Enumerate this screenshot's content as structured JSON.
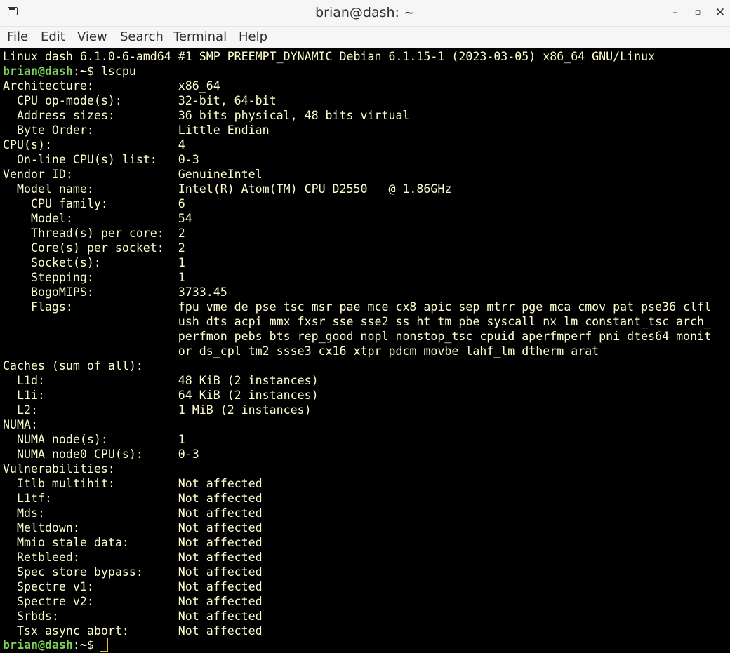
{
  "window": {
    "title": "brian@dash: ~",
    "icon": "terminal-icon",
    "controls": {
      "minimize": "–",
      "maximize": "▫",
      "close": "✕"
    }
  },
  "menu": {
    "file": "File",
    "edit": "Edit",
    "view": "View",
    "search": "Search",
    "terminal": "Terminal",
    "help": "Help"
  },
  "terminal": {
    "colors": {
      "text": "#ffffcc",
      "prompt_user": "#7ed35c",
      "cursor": "#e6c229",
      "background": "#000000"
    },
    "banner": "Linux dash 6.1.0-6-amd64 #1 SMP PREEMPT_DYNAMIC Debian 6.1.15-1 (2023-03-05) x86_64 GNU/Linux",
    "prompt1": {
      "user_host": "brian@dash",
      "colon": ":",
      "path": "~",
      "dollar": "$ ",
      "command": "lscpu"
    },
    "output": [
      "Architecture:            x86_64",
      "  CPU op-mode(s):        32-bit, 64-bit",
      "  Address sizes:         36 bits physical, 48 bits virtual",
      "  Byte Order:            Little Endian",
      "CPU(s):                  4",
      "  On-line CPU(s) list:   0-3",
      "Vendor ID:               GenuineIntel",
      "  Model name:            Intel(R) Atom(TM) CPU D2550   @ 1.86GHz",
      "    CPU family:          6",
      "    Model:               54",
      "    Thread(s) per core:  2",
      "    Core(s) per socket:  2",
      "    Socket(s):           1",
      "    Stepping:            1",
      "    BogoMIPS:            3733.45",
      "    Flags:               fpu vme de pse tsc msr pae mce cx8 apic sep mtrr pge mca cmov pat pse36 clfl",
      "                         ush dts acpi mmx fxsr sse sse2 ss ht tm pbe syscall nx lm constant_tsc arch_",
      "                         perfmon pebs bts rep_good nopl nonstop_tsc cpuid aperfmperf pni dtes64 monit",
      "                         or ds_cpl tm2 ssse3 cx16 xtpr pdcm movbe lahf_lm dtherm arat",
      "Caches (sum of all):",
      "  L1d:                   48 KiB (2 instances)",
      "  L1i:                   64 KiB (2 instances)",
      "  L2:                    1 MiB (2 instances)",
      "NUMA:",
      "  NUMA node(s):          1",
      "  NUMA node0 CPU(s):     0-3",
      "Vulnerabilities:",
      "  Itlb multihit:         Not affected",
      "  L1tf:                  Not affected",
      "  Mds:                   Not affected",
      "  Meltdown:              Not affected",
      "  Mmio stale data:       Not affected",
      "  Retbleed:              Not affected",
      "  Spec store bypass:     Not affected",
      "  Spectre v1:            Not affected",
      "  Spectre v2:            Not affected",
      "  Srbds:                 Not affected",
      "  Tsx async abort:       Not affected"
    ],
    "prompt2": {
      "user_host": "brian@dash",
      "colon": ":",
      "path": "~",
      "dollar": "$ "
    }
  }
}
